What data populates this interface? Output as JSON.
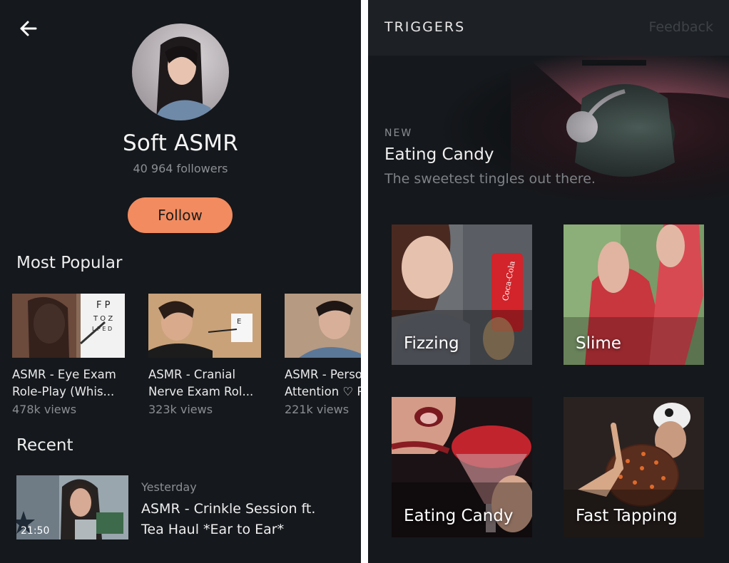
{
  "profile": {
    "channel_name": "Soft ASMR",
    "followers": "40 964 followers",
    "follow_label": "Follow"
  },
  "most_popular": {
    "title": "Most Popular",
    "videos": [
      {
        "title_line1": "ASMR - Eye Exam",
        "title_line2": "Role-Play (Whis...",
        "views": "478k views"
      },
      {
        "title_line1": "ASMR - Cranial",
        "title_line2": "Nerve Exam Rol...",
        "views": "323k views"
      },
      {
        "title_line1": "ASMR - Perso",
        "title_line2": "Attention ♡ P",
        "views": "221k views"
      }
    ]
  },
  "recent": {
    "title": "Recent",
    "items": [
      {
        "date": "Yesterday",
        "title_line1": "ASMR - Crinkle Session ft.",
        "title_line2": "Tea Haul *Ear to Ear*",
        "duration": "21:50"
      }
    ]
  },
  "triggers": {
    "header_title": "TRIGGERS",
    "feedback_label": "Feedback",
    "featured": {
      "badge": "NEW",
      "title": "Eating Candy",
      "subtitle": "The sweetest tingles out there."
    },
    "tiles": [
      {
        "label": "Fizzing"
      },
      {
        "label": "Slime"
      },
      {
        "label": "Eating Candy"
      },
      {
        "label": "Fast Tapping"
      }
    ]
  },
  "colors": {
    "background": "#15181c",
    "topbar": "#1d2125",
    "accent": "#f28b5f",
    "muted_text": "#8a8d91"
  },
  "icons": {
    "back": "arrow-left-icon"
  }
}
